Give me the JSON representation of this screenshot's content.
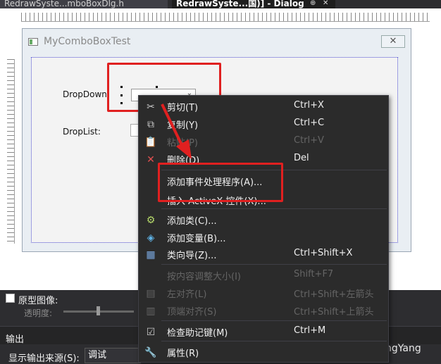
{
  "tabs": {
    "tab1_label": "RedrawSyste...mboBoxDlg.h",
    "tab2_label": "RedrawSyste...国)] - Dialog",
    "tab2_pin": "⊕",
    "tab2_close": "✕"
  },
  "dialog": {
    "title": "MyComboBoxTest",
    "close_glyph": "✕",
    "dropdown_label": "DropDown:",
    "droplist_label": "DropList:",
    "combo_arrow": "⌄"
  },
  "bottom": {
    "prototype_label": "原型图像:",
    "opacity_label": "透明度:",
    "output_title": "输出",
    "output_source_label": "显示输出来源(S):",
    "output_source_value": "调试",
    "watermark": "CSDN @SunkingYang"
  },
  "context_menu": {
    "items": [
      {
        "icon": "cut-icon",
        "glyph": "✂",
        "label": "剪切(T)",
        "shortcut": "Ctrl+X",
        "enabled": true
      },
      {
        "icon": "copy-icon",
        "glyph": "⧉",
        "label": "复制(Y)",
        "shortcut": "Ctrl+C",
        "enabled": true
      },
      {
        "icon": "paste-icon",
        "glyph": "📋",
        "label": "粘贴(P)",
        "shortcut": "Ctrl+V",
        "enabled": false
      },
      {
        "icon": "delete-icon",
        "glyph": "✕",
        "label": "删除(D)",
        "shortcut": "Del",
        "enabled": true
      },
      {
        "icon": "",
        "glyph": "",
        "label": "添加事件处理程序(A)...",
        "shortcut": "",
        "enabled": true
      },
      {
        "icon": "",
        "glyph": "",
        "label": "插入 ActiveX 控件(X)...",
        "shortcut": "",
        "enabled": true
      },
      {
        "icon": "add-class-icon",
        "glyph": "⚙",
        "label": "添加类(C)...",
        "shortcut": "",
        "enabled": true
      },
      {
        "icon": "add-variable-icon",
        "glyph": "◈",
        "label": "添加变量(B)...",
        "shortcut": "",
        "enabled": true
      },
      {
        "icon": "class-wizard-icon",
        "glyph": "▦",
        "label": "类向导(Z)...",
        "shortcut": "Ctrl+Shift+X",
        "enabled": true
      },
      {
        "icon": "",
        "glyph": "",
        "label": "按内容调整大小(I)",
        "shortcut": "Shift+F7",
        "enabled": false
      },
      {
        "icon": "align-left-icon",
        "glyph": "▤",
        "label": "左对齐(L)",
        "shortcut": "Ctrl+Shift+左箭头",
        "enabled": false
      },
      {
        "icon": "align-top-icon",
        "glyph": "▥",
        "label": "顶端对齐(S)",
        "shortcut": "Ctrl+Shift+上箭头",
        "enabled": false
      },
      {
        "icon": "check-mnemonics-icon",
        "glyph": "☑",
        "label": "检查助记键(M)",
        "shortcut": "Ctrl+M",
        "enabled": true
      },
      {
        "icon": "properties-icon",
        "glyph": "🔧",
        "label": "属性(R)",
        "shortcut": "",
        "enabled": true
      }
    ]
  },
  "colors": {
    "menu_bg": "#2b2b2b",
    "highlight_red": "#e02020",
    "ide_dark": "#2d2d30"
  }
}
